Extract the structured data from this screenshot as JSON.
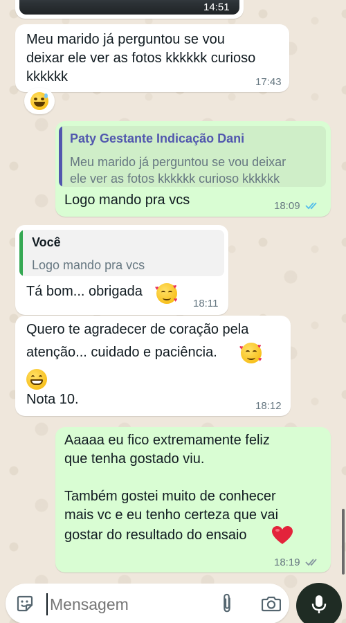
{
  "messages": [
    {
      "id": "m0",
      "direction": "incoming",
      "time": "14:51",
      "type": "image"
    },
    {
      "id": "m1",
      "direction": "incoming",
      "lines": [
        "Meu marido já perguntou se vou",
        "deixar ele ver as fotos kkkkkk curioso",
        "kkkkkk"
      ],
      "time": "17:43",
      "reaction": "grinning-sweat-emoji"
    },
    {
      "id": "m2",
      "direction": "outgoing",
      "quote": {
        "author": "Paty Gestante Indicação Dani",
        "lines": [
          "Meu marido já perguntou se vou deixar",
          "ele ver as fotos kkkkkk curioso kkkkkk"
        ]
      },
      "text": "Logo mando pra vcs",
      "time": "18:09",
      "status": "read"
    },
    {
      "id": "m3",
      "direction": "incoming",
      "quote": {
        "author": "Você",
        "lines": [
          "Logo mando pra vcs"
        ]
      },
      "text": "Tá bom... obrigada",
      "time": "18:11",
      "emoji": "smiling-face-with-hearts"
    },
    {
      "id": "m4",
      "direction": "incoming",
      "lines": [
        "Quero te agradecer de coração pela",
        "atenção... cuidado e paciência.",
        "Nota 10."
      ],
      "time": "18:12",
      "emojis": [
        "smiling-face-with-hearts",
        "grinning-face"
      ]
    },
    {
      "id": "m5",
      "direction": "outgoing",
      "paragraph1": [
        "Aaaaa eu fico extremamente feliz",
        "que tenha gostado viu."
      ],
      "paragraph2": [
        "Também gostei muito de conhecer",
        "mais vc e eu tenho certeza que vai",
        "gostar do resultado do ensaio"
      ],
      "time": "18:19",
      "status": "delivered",
      "emoji": "red-heart"
    }
  ],
  "composer": {
    "placeholder": "Mensagem"
  },
  "colors": {
    "incoming_bubble": "#ffffff",
    "outgoing_bubble": "#d9fdd3",
    "read_ticks": "#53bdeb",
    "unread_ticks": "#8696a0",
    "quote_outgoing_accent": "#5157ae",
    "quote_incoming_accent": "#35a853",
    "mic_button": "#1f2c24"
  }
}
